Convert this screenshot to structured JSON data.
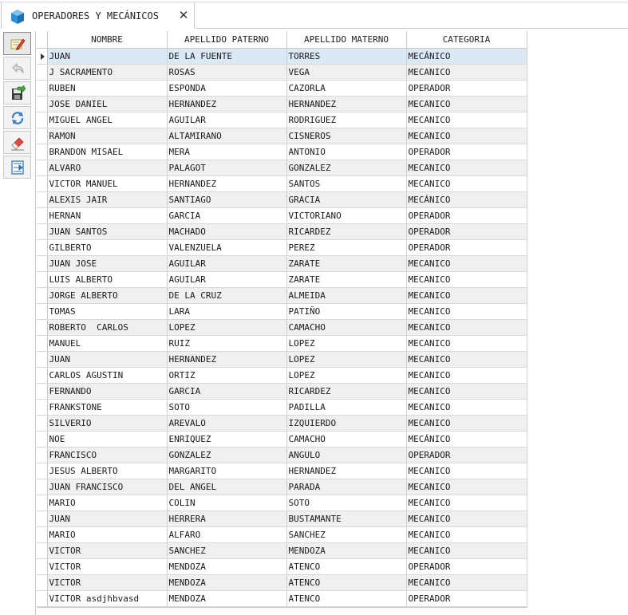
{
  "tab": {
    "title": "OPERADORES Y MECÁNICOS",
    "icon": "cube-icon",
    "close_icon": "close-icon"
  },
  "toolbar": [
    {
      "name": "edit-button",
      "icon": "edit-pencil-icon"
    },
    {
      "name": "undo-button",
      "icon": "undo-arrow-icon"
    },
    {
      "name": "save-button",
      "icon": "save-export-icon"
    },
    {
      "name": "refresh-button",
      "icon": "refresh-icon"
    },
    {
      "name": "erase-button",
      "icon": "eraser-icon"
    },
    {
      "name": "export-button",
      "icon": "export-sheet-icon"
    }
  ],
  "table": {
    "columns": [
      "NOMBRE",
      "APELLIDO PATERNO",
      "APELLIDO MATERNO",
      "CATEGORIA"
    ],
    "selected_row": 0,
    "rows": [
      [
        "JUAN",
        "DE LA FUENTE",
        "TORRES",
        "MECÁNICO"
      ],
      [
        "J SACRAMENTO",
        "ROSAS",
        "VEGA",
        "MECANICO"
      ],
      [
        "RUBEN",
        "ESPONDA",
        "CAZORLA",
        "OPERADOR"
      ],
      [
        "JOSE DANIEL",
        "HERNANDEZ",
        "HERNANDEZ",
        "MECANICO"
      ],
      [
        "MIGUEL ANGEL",
        "AGUILAR",
        "RODRIGUEZ",
        "MECANICO"
      ],
      [
        "RAMON",
        "ALTAMIRANO",
        "CISNEROS",
        "MECANICO"
      ],
      [
        "BRANDON MISAEL",
        "MERA",
        "ANTONIO",
        "OPERADOR"
      ],
      [
        "ALVARO",
        "PALAGOT",
        "GONZALEZ",
        "MECANICO"
      ],
      [
        "VICTOR MANUEL",
        "HERNANDEZ",
        "SANTOS",
        "MECANICO"
      ],
      [
        "ALEXIS JAIR",
        "SANTIAGO",
        "GRACIA",
        "MECÁNICO"
      ],
      [
        "HERNAN",
        "GARCIA",
        "VICTORIANO",
        "OPERADOR"
      ],
      [
        "JUAN SANTOS",
        "MACHADO",
        "RICARDEZ",
        "OPERADOR"
      ],
      [
        "GILBERTO",
        "VALENZUELA",
        "PEREZ",
        "OPERADOR"
      ],
      [
        "JUAN JOSE",
        "AGUILAR",
        "ZARATE",
        "MECANICO"
      ],
      [
        "LUIS ALBERTO",
        "AGUILAR",
        "ZARATE",
        "MECANICO"
      ],
      [
        "JORGE ALBERTO",
        "DE LA CRUZ",
        "ALMEIDA",
        "MECANICO"
      ],
      [
        "TOMAS",
        "LARA",
        "PATIÑO",
        "MECANICO"
      ],
      [
        "ROBERTO  CARLOS",
        "LOPEZ",
        "CAMACHO",
        "MECANICO"
      ],
      [
        "MANUEL",
        "RUIZ",
        "LOPEZ",
        "MECANICO"
      ],
      [
        "JUAN",
        "HERNANDEZ",
        "LOPEZ",
        "MECANICO"
      ],
      [
        "CARLOS AGUSTIN",
        "ORTIZ",
        "LOPEZ",
        "MECANICO"
      ],
      [
        "FERNANDO",
        "GARCIA",
        "RICARDEZ",
        "MECANICO"
      ],
      [
        "FRANKSTONE",
        "SOTO",
        "PADILLA",
        "MECANICO"
      ],
      [
        "SILVERIO",
        "AREVALO",
        "IZQUIERDO",
        "MECANICO"
      ],
      [
        "NOE",
        "ENRIQUEZ",
        "CAMACHO",
        "MECÁNICO"
      ],
      [
        "FRANCISCO",
        "GONZALEZ",
        "ANGULO",
        "OPERADOR"
      ],
      [
        "JESUS ALBERTO",
        "MARGARITO",
        "HERNANDEZ",
        "MECANICO"
      ],
      [
        "JUAN FRANCISCO",
        "DEL ANGEL",
        "PARADA",
        "MECANICO"
      ],
      [
        "MARIO",
        "COLIN",
        "SOTO",
        "MECANICO"
      ],
      [
        "JUAN",
        "HERRERA",
        "BUSTAMANTE",
        "MECANICO"
      ],
      [
        "MARIO",
        "ALFARO",
        "SANCHEZ",
        "MECANICO"
      ],
      [
        "VICTOR",
        "SANCHEZ",
        "MENDOZA",
        "MECANICO"
      ],
      [
        "VICTOR",
        "MENDOZA",
        "ATENCO",
        "OPERADOR"
      ],
      [
        "VICTOR",
        "MENDOZA",
        "ATENCO",
        "MECANICO"
      ],
      [
        "VICTOR asdjhbvasd",
        "MENDOZA",
        "ATENCO",
        "OPERADOR"
      ]
    ]
  }
}
